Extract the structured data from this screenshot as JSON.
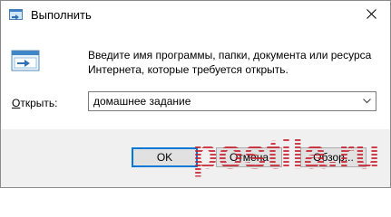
{
  "window": {
    "title": "Выполнить",
    "close_icon": "close-icon",
    "app_icon": "run-dialog-icon"
  },
  "content": {
    "description_line1": "Введите имя программы, папки, документа или ресурса",
    "description_line2": "Интернета, которые требуется открыть.",
    "open_label_accel": "О",
    "open_label_rest": "ткрыть:",
    "open_value": "домашнее задание"
  },
  "buttons": {
    "ok": "OK",
    "cancel": "Отмена",
    "browse": "Обзор..."
  },
  "watermark": {
    "text": "postila.ru"
  },
  "colors": {
    "accent": "#0078d7",
    "footer_bg": "#f0f0f0",
    "button_bg": "#e1e1e1"
  }
}
